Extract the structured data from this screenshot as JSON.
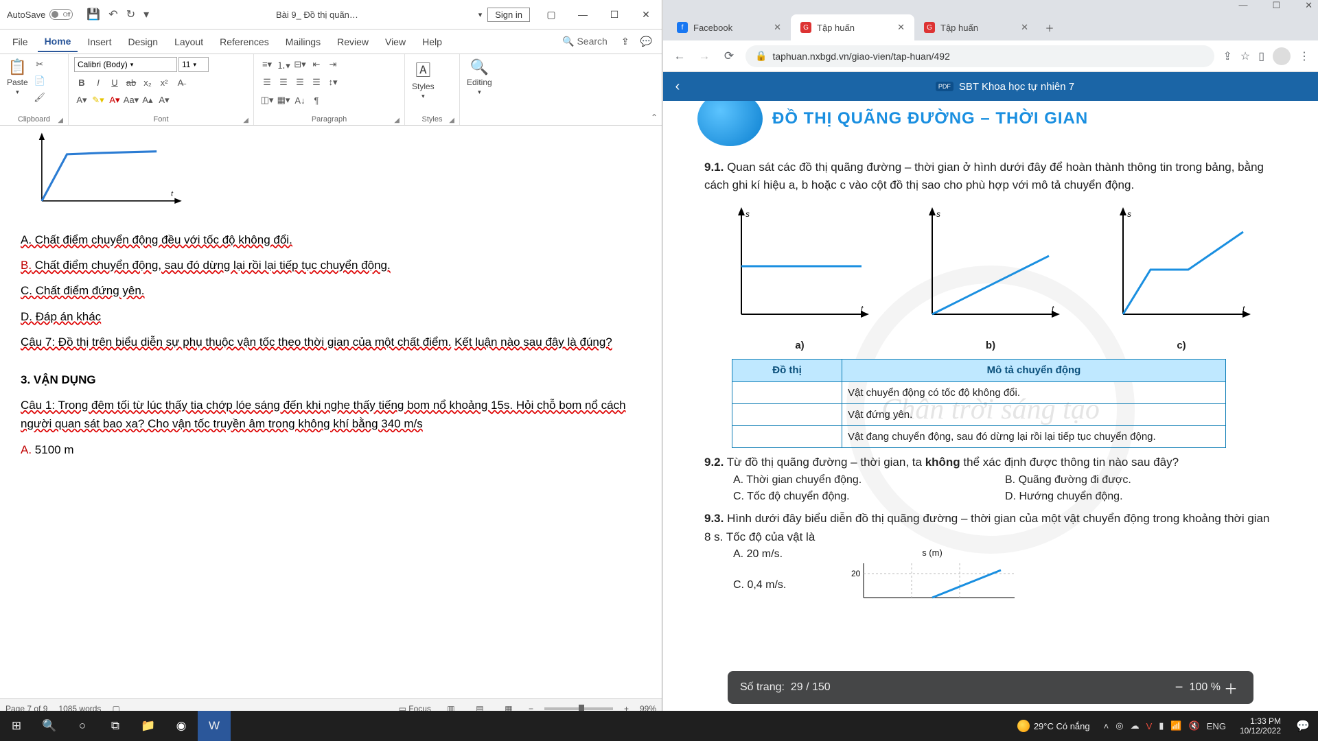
{
  "word": {
    "title": {
      "autosave_label": "AutoSave",
      "autosave_state": "Off",
      "docname": "Bài 9_ Đồ thị quãn…",
      "signin": "Sign in"
    },
    "tabs": {
      "file": "File",
      "home": "Home",
      "insert": "Insert",
      "design": "Design",
      "layout": "Layout",
      "references": "References",
      "mailings": "Mailings",
      "review": "Review",
      "view": "View",
      "help": "Help",
      "search": "Search"
    },
    "ribbon": {
      "clipboard": "Clipboard",
      "paste": "Paste",
      "font_group": "Font",
      "font_name": "Calibri (Body)",
      "font_size": "11",
      "paragraph": "Paragraph",
      "styles": "Styles",
      "editing": "Editing"
    },
    "doc": {
      "optA": "A. Chất điểm chuyển động đều với tốc độ không đổi.",
      "optB_letter": "B.",
      "optB": " Chất điểm chuyển động, sau đó dừng lại rồi lại tiếp tục chuyển động.",
      "optC": "C. Chất điểm đứng yên.",
      "optD": "D. Đáp án khác",
      "q7a": "Câu 7: Đồ thị trên biểu diễn sự phụ thuộc vận tốc theo thời gian của một chất điểm.",
      "q7b": "Kết luận nào sau đây là đúng?",
      "section": "3. VẬN DỤNG",
      "q1": "Câu 1: Trong đêm tối từ lúc thấy tia chớp lóe sáng đến khi nghe thấy tiếng bom nổ khoảng 15s. Hỏi chỗ bom nổ cách người quan sát bao xa? Cho vận tốc truyền âm trong không khí bằng 340 m/s",
      "ansA_letter": "A.",
      "ansA": " 5100 m"
    },
    "status": {
      "page": "Page 7 of 9",
      "words": "1085 words",
      "focus": "Focus",
      "zoom": "99%"
    }
  },
  "chrome": {
    "tabs": [
      {
        "label": "Facebook",
        "fav_bg": "#1877f2",
        "fav_txt": "f"
      },
      {
        "label": "Tập huấn",
        "fav_bg": "#d33",
        "fav_txt": "GD"
      },
      {
        "label": "Tập huấn",
        "fav_bg": "#d33",
        "fav_txt": "GD"
      }
    ],
    "url": "taphuan.nxbgd.vn/giao-vien/tap-huan/492",
    "header_title": "SBT Khoa học tự nhiên 7",
    "header_badge": "PDF",
    "pdf": {
      "header_art": "ĐỒ THỊ QUÃNG ĐƯỜNG – THỜI GIAN",
      "q91_num": "9.1.",
      "q91": " Quan sát các đồ thị quãng đường – thời gian ở hình dưới đây để hoàn thành thông tin trong bảng, bằng cách ghi kí hiệu a, b hoặc c vào cột đồ thị sao cho phù hợp với mô tả chuyển động.",
      "label_a": "a)",
      "label_b": "b)",
      "label_c": "c)",
      "th1": "Đồ thị",
      "th2": "Mô tả chuyển động",
      "r1": "Vật chuyển động có tốc độ không đổi.",
      "r2": "Vật đứng yên.",
      "r3": "Vật đang chuyển động, sau đó dừng lại rồi lại tiếp tục chuyển động.",
      "q92_num": "9.2.",
      "q92": " Từ đồ thị quãng đường – thời gian, ta ",
      "q92_bold": "không",
      "q92_tail": " thể xác định được thông tin nào sau đây?",
      "q92a": "A. Thời gian chuyển động.",
      "q92b": "B. Quãng đường đi được.",
      "q92c": "C. Tốc độ chuyển động.",
      "q92d": "D. Hướng chuyển động.",
      "q93_num": "9.3.",
      "q93": " Hình dưới đây biểu diễn đồ thị quãng đường – thời gian của một vật chuyển động trong khoảng thời gian 8 s. Tốc độ của vật là",
      "q93a": "A. 20 m/s.",
      "q93c": "C. 0,4 m/s.",
      "ylabel": "s (m)",
      "ytick": "20",
      "wm": "Chân trời sáng tạo"
    },
    "float": {
      "page_label": "Số trang:",
      "page_val": "29 / 150",
      "zoom": "100 %"
    }
  },
  "taskbar": {
    "weather": "29°C  Có nắng",
    "lang": "ENG",
    "time": "1:33 PM",
    "date": "10/12/2022"
  },
  "chart_data": [
    {
      "type": "line",
      "title": "word-doc mini chart",
      "x": [
        0,
        1,
        3,
        6
      ],
      "y": [
        0,
        3,
        3.2,
        3.2
      ],
      "ylabel": "",
      "xlabel": "t"
    },
    {
      "type": "line",
      "title": "graph a",
      "x": [
        0,
        10
      ],
      "y": [
        5,
        5
      ],
      "xlabel": "t",
      "ylabel": "s"
    },
    {
      "type": "line",
      "title": "graph b",
      "x": [
        0,
        10
      ],
      "y": [
        0,
        6
      ],
      "xlabel": "t",
      "ylabel": "s"
    },
    {
      "type": "line",
      "title": "graph c",
      "x": [
        0,
        3,
        6,
        10
      ],
      "y": [
        0,
        4,
        4,
        7
      ],
      "xlabel": "t",
      "ylabel": "s"
    }
  ]
}
